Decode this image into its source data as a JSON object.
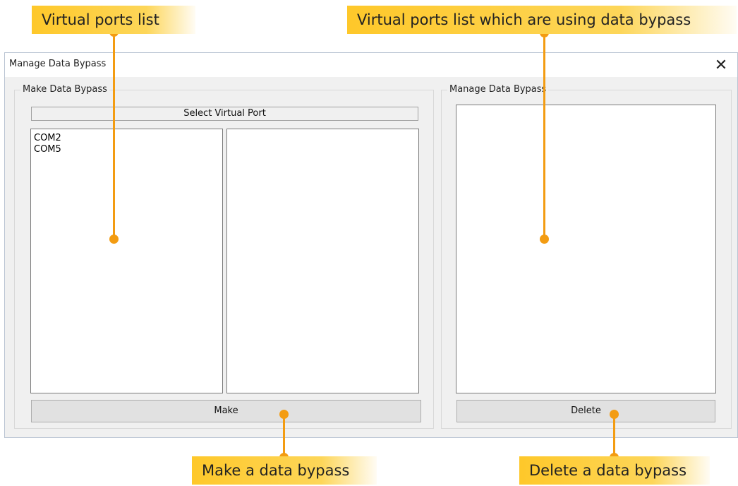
{
  "window": {
    "title": "Manage Data Bypass",
    "close_glyph": "✕"
  },
  "make_group": {
    "label": "Make Data Bypass",
    "select_header": "Select Virtual Port",
    "ports": [
      "COM2",
      "COM5"
    ],
    "make_button": "Make"
  },
  "manage_group": {
    "label": "Manage Data Bypass",
    "delete_button": "Delete"
  },
  "callouts": {
    "ports_list": "Virtual ports list",
    "bypass_list": "Virtual ports list which are using data bypass",
    "make": "Make a data bypass",
    "delete": "Delete a data bypass"
  },
  "colors": {
    "accent": "#f39c12",
    "callout": "#fec82a"
  }
}
